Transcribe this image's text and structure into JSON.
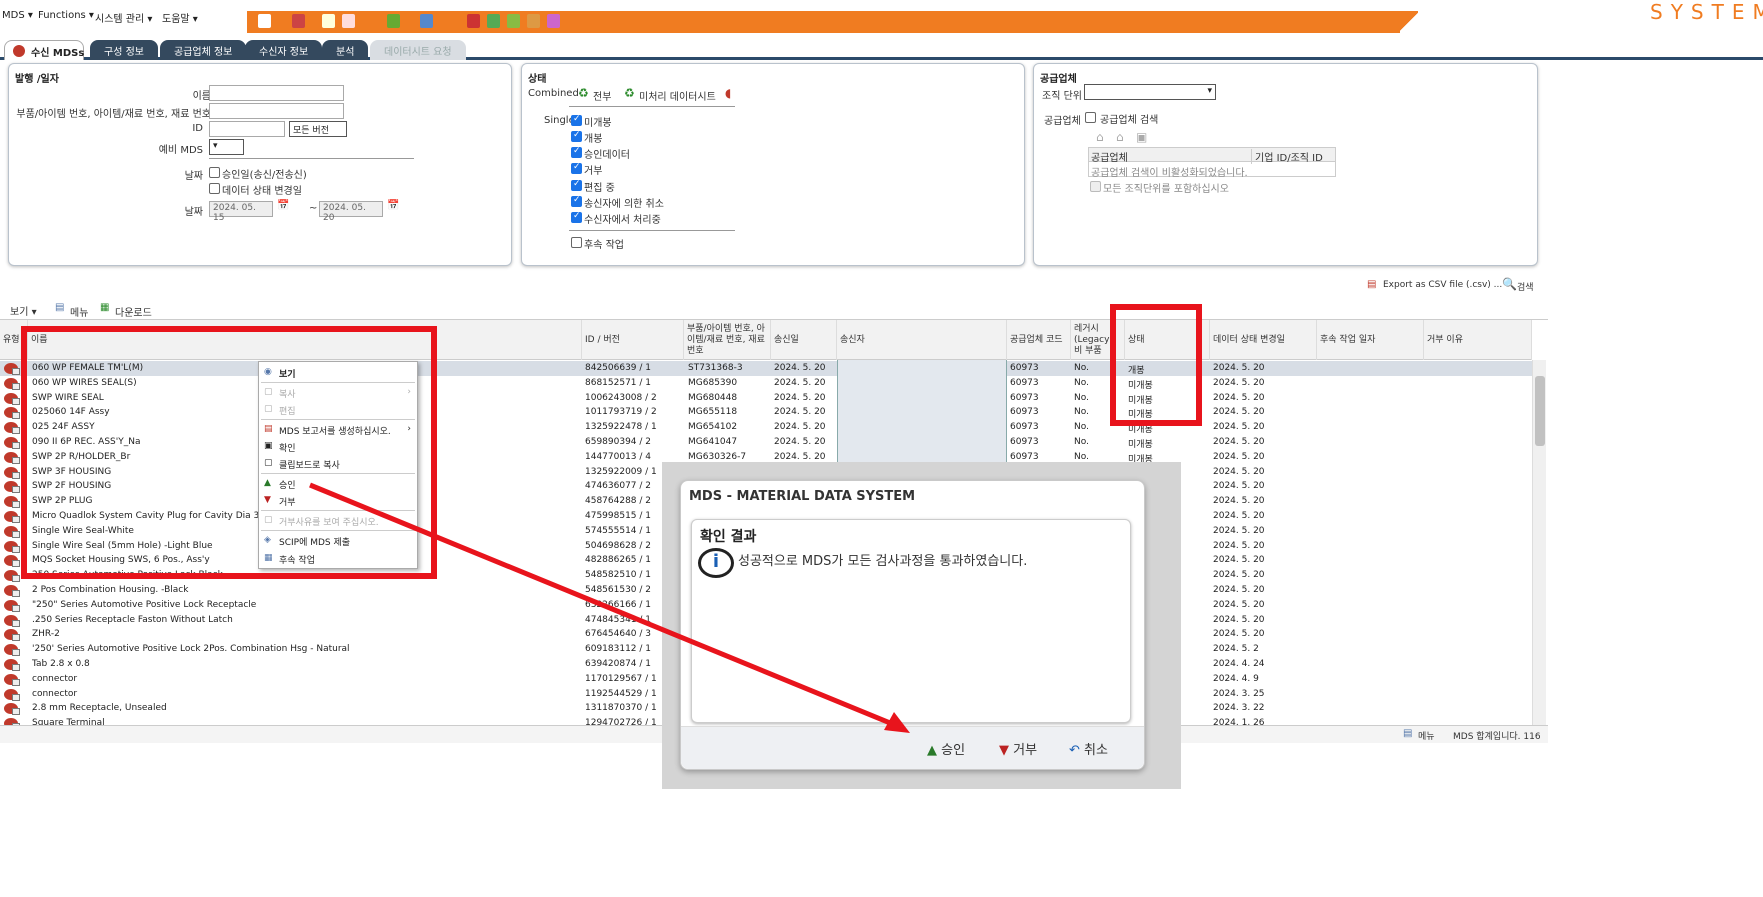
{
  "menubar": {
    "items": [
      "MDS ▾",
      "Functions ▾",
      "시스템 관리 ▾",
      "도움말 ▾"
    ],
    "brand": "SYSTEM"
  },
  "tabs": [
    {
      "label": "수신 MDSs"
    },
    {
      "label": "구성 정보"
    },
    {
      "label": "공급업체 정보"
    },
    {
      "label": "수신자 정보"
    },
    {
      "label": "분석"
    },
    {
      "label": "데이터시트 요청"
    }
  ],
  "panel_issue": {
    "title": "발행 /일자",
    "name_label": "이름",
    "part_label": "부품/아이템 번호, 아이템/재료 번호, 재료 번호",
    "id_label": "ID",
    "version_select": "모든 버전",
    "backup_label": "예비 MDS",
    "date_label": "날짜",
    "opt1": "승인일(송신/전송신)",
    "opt2": "데이터 상태 변경일",
    "date_label2": "날짜",
    "date_from": "2024. 05. 15",
    "tilde": "~",
    "date_to": "2024. 05. 20"
  },
  "panel_status": {
    "title": "상태",
    "combined": "Combined",
    "all": "전부",
    "unprocessed": "미처리 데이터시트",
    "single": "Single",
    "items": [
      "미개봉",
      "개봉",
      "승인데이터",
      "거부",
      "편집 중",
      "송신자에 의한 취소",
      "수신자에서 처리중"
    ],
    "followup": "후속 작업"
  },
  "panel_supplier": {
    "title": "공급업체",
    "org_label": "조직 단위",
    "sup_label": "공급업체",
    "sup_search": "공급업체 검색",
    "col1": "공급업체",
    "col2": "기업 ID/조직 ID",
    "disabled_msg": "공급업체 검색이 비활성화되었습니다.",
    "include_all": "모든 조직단위를 포함하십시오"
  },
  "toolbar": {
    "view": "보기 ▾",
    "menu": "메뉴",
    "download": "다운로드",
    "export": "Export as CSV file (.csv) ...",
    "search": "검색"
  },
  "grid": {
    "headers": [
      "유형",
      "이름",
      "ID / 버전",
      "부품/아이템 번호, 아이템/재료 번호, 재료 번호",
      "송신일",
      "송신자",
      "공급업체 코드",
      "레거시 (Legacy) 비 부품",
      "상태",
      "데이터 상태 변경일",
      "후속 작업 일자",
      "거부 이유"
    ],
    "rows": [
      {
        "name": "060 WP FEMALE TM'L(M)",
        "id": "842506639 / 1",
        "part": "ST731368-3",
        "date": "2024. 5. 20",
        "code": "60973",
        "legacy": "No.",
        "status": "개봉",
        "changed": "2024. 5. 20"
      },
      {
        "name": "060 WP WIRES SEAL(S)",
        "id": "868152571 / 1",
        "part": "MG685390",
        "date": "2024. 5. 20",
        "code": "60973",
        "legacy": "No.",
        "status": "미개봉",
        "changed": "2024. 5. 20"
      },
      {
        "name": "SWP WIRE SEAL",
        "id": "1006243008 / 2",
        "part": "MG680448",
        "date": "2024. 5. 20",
        "code": "60973",
        "legacy": "No.",
        "status": "미개봉",
        "changed": "2024. 5. 20"
      },
      {
        "name": "025060 14F Assy",
        "id": "1011793719 / 2",
        "part": "MG655118",
        "date": "2024. 5. 20",
        "code": "60973",
        "legacy": "No.",
        "status": "미개봉",
        "changed": "2024. 5. 20"
      },
      {
        "name": "025 24F ASSY",
        "id": "1325922478 / 1",
        "part": "MG654102",
        "date": "2024. 5. 20",
        "code": "60973",
        "legacy": "No.",
        "status": "미개봉",
        "changed": "2024. 5. 20"
      },
      {
        "name": "090 II 6P REC. ASS'Y_Na",
        "id": "659890394 / 2",
        "part": "MG641047",
        "date": "2024. 5. 20",
        "code": "60973",
        "legacy": "No.",
        "status": "미개봉",
        "changed": "2024. 5. 20"
      },
      {
        "name": "SWP 2P R/HOLDER_Br",
        "id": "144770013 / 4",
        "part": "MG630326-7",
        "date": "2024. 5. 20",
        "code": "60973",
        "legacy": "No.",
        "status": "미개봉",
        "changed": "2024. 5. 20"
      },
      {
        "name": "SWP 3F HOUSING",
        "id": "1325922009 / 1",
        "part": "",
        "date": "",
        "code": "",
        "legacy": "",
        "status": "",
        "changed": "2024. 5. 20"
      },
      {
        "name": "SWP 2F HOUSING",
        "id": "474636077 / 2",
        "part": "",
        "date": "",
        "code": "",
        "legacy": "",
        "status": "",
        "changed": "2024. 5. 20"
      },
      {
        "name": "SWP 2P PLUG",
        "id": "458764288 / 2",
        "part": "",
        "date": "",
        "code": "",
        "legacy": "",
        "status": "",
        "changed": "2024. 5. 20"
      },
      {
        "name": "Micro Quadlok System Cavity Plug for Cavity Dia 3.45mm",
        "id": "475998515 / 1",
        "part": "",
        "date": "",
        "code": "",
        "legacy": "",
        "status": "",
        "changed": "2024. 5. 20"
      },
      {
        "name": "Single Wire Seal-White",
        "id": "574555514 / 1",
        "part": "",
        "date": "",
        "code": "",
        "legacy": "",
        "status": "",
        "changed": "2024. 5. 20"
      },
      {
        "name": "Single Wire Seal (5mm Hole) -Light Blue",
        "id": "504698628 / 2",
        "part": "",
        "date": "",
        "code": "",
        "legacy": "",
        "status": "",
        "changed": "2024. 5. 20"
      },
      {
        "name": "MQS Socket Housing SWS, 6 Pos., Ass'y",
        "id": "482886265 / 1",
        "part": "",
        "date": "",
        "code": "",
        "legacy": "",
        "status": "",
        "changed": "2024. 5. 20"
      },
      {
        "name": "250 Series Automotive Positive Lock Black",
        "id": "548582510 / 1",
        "part": "",
        "date": "",
        "code": "",
        "legacy": "",
        "status": "",
        "changed": "2024. 5. 20"
      },
      {
        "name": "2 Pos Combination Housing. -Black",
        "id": "548561530 / 2",
        "part": "",
        "date": "",
        "code": "",
        "legacy": "",
        "status": "",
        "changed": "2024. 5. 20"
      },
      {
        "name": "\"250\" Series Automotive Positive Lock Receptacle",
        "id": "632266166 / 1",
        "part": "",
        "date": "",
        "code": "",
        "legacy": "",
        "status": "",
        "changed": "2024. 5. 20"
      },
      {
        "name": ".250 Series Receptacle Faston Without Latch",
        "id": "474845341 / 1",
        "part": "",
        "date": "",
        "code": "",
        "legacy": "",
        "status": "",
        "changed": "2024. 5. 20"
      },
      {
        "name": "ZHR-2",
        "id": "676454640 / 3",
        "part": "",
        "date": "",
        "code": "",
        "legacy": "",
        "status": "",
        "changed": "2024. 5. 20"
      },
      {
        "name": "'250' Series Automotive Positive Lock 2Pos. Combination Hsg - Natural",
        "id": "609183112 / 1",
        "part": "",
        "date": "",
        "code": "",
        "legacy": "",
        "status": "",
        "changed": "2024. 5. 2"
      },
      {
        "name": "Tab 2.8 x 0.8",
        "id": "639420874 / 1",
        "part": "",
        "date": "",
        "code": "",
        "legacy": "",
        "status": "",
        "changed": "2024. 4. 24"
      },
      {
        "name": "connector",
        "id": "1170129567 / 1",
        "part": "",
        "date": "",
        "code": "",
        "legacy": "",
        "status": "",
        "changed": "2024. 4. 9"
      },
      {
        "name": "connector",
        "id": "1192544529 / 1",
        "part": "",
        "date": "",
        "code": "",
        "legacy": "",
        "status": "",
        "changed": "2024. 3. 25"
      },
      {
        "name": "2.8 mm Receptacle, Unsealed",
        "id": "1311870370 / 1",
        "part": "",
        "date": "",
        "code": "",
        "legacy": "",
        "status": "",
        "changed": "2024. 3. 22"
      },
      {
        "name": "Square Terminal",
        "id": "1294702726 / 1",
        "part": "",
        "date": "",
        "code": "",
        "legacy": "",
        "status": "",
        "changed": "2024. 1. 26"
      }
    ]
  },
  "context_menu": {
    "items": [
      "보기",
      "복사",
      "편집",
      "MDS 보고서를 생성하십시오.",
      "확인",
      "클립보드로 복사",
      "승인",
      "거부",
      "거부사유를 보여 주십시오.",
      "SCIP에 MDS 제출",
      "후속 작업"
    ]
  },
  "dialog": {
    "title": "MDS - MATERIAL DATA SYSTEM",
    "heading": "확인 결과",
    "message": "성공적으로 MDS가 모든 검사과정을 통과하였습니다.",
    "approve": "승인",
    "reject": "거부",
    "cancel": "취소"
  },
  "statusbar": {
    "menu": "메뉴",
    "total": "MDS 합계입니다.  116"
  },
  "colors": {
    "accent": "#f07c21",
    "highlight": "#e8141c",
    "tab": "#34495e"
  }
}
